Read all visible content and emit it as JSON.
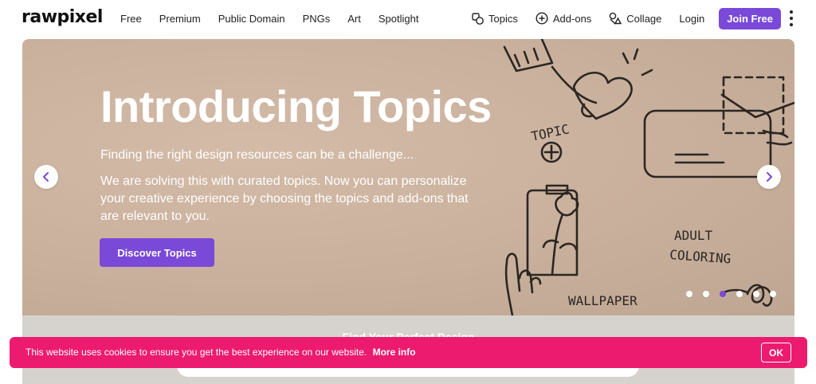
{
  "brand": {
    "logo_text": "rawpixel",
    "accent_color": "#7a49d8",
    "cookie_color": "#ec1b6f"
  },
  "nav": {
    "items": [
      "Free",
      "Premium",
      "Public Domain",
      "PNGs",
      "Art",
      "Spotlight"
    ]
  },
  "right_nav": {
    "topics": {
      "label": "Topics",
      "icon": "topics-icon"
    },
    "addons": {
      "label": "Add-ons",
      "icon": "plus-circle-icon"
    },
    "collage": {
      "label": "Collage",
      "icon": "collage-icon"
    },
    "login": "Login",
    "join": "Join Free"
  },
  "hero": {
    "title": "Introducing Topics",
    "subtitle": "Finding the right design resources can be a challenge...",
    "body": "We are solving this with curated topics. Now you can personalize your creative experience by choosing the topics and add-ons that are relevant to you.",
    "cta": "Discover Topics",
    "doodle_labels": {
      "topic": "TOPIC",
      "adult": "ADULT",
      "coloring": "COLORING",
      "wallpaper": "WALLPAPER"
    },
    "carousel": {
      "total": 6,
      "active": 3
    }
  },
  "search_section": {
    "title": "Find Your Perfect Design"
  },
  "cookie": {
    "message": "This website uses cookies to ensure you get the best experience on our website.",
    "link": "More info",
    "ok": "OK"
  }
}
